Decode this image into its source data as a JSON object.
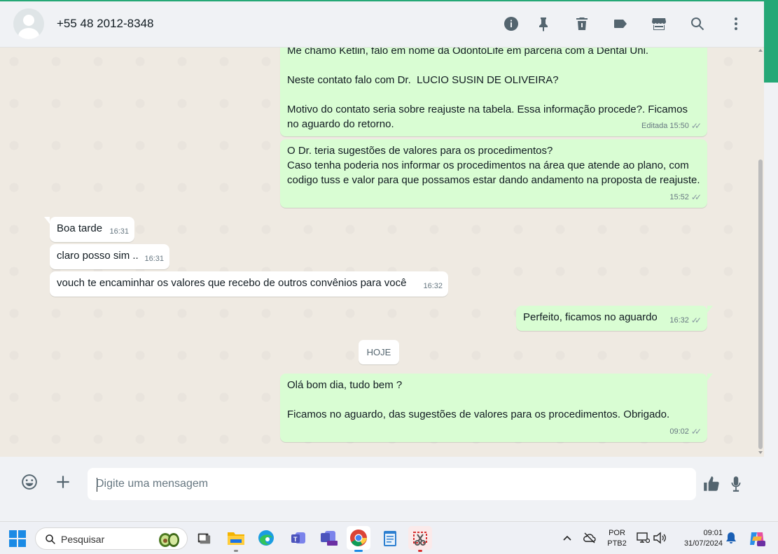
{
  "header": {
    "contact": "+55 48 2012-8348",
    "icons": [
      "info-icon",
      "pin-icon",
      "delete-icon",
      "label-icon",
      "store-icon",
      "search-icon",
      "menu-icon"
    ]
  },
  "messages": [
    {
      "dir": "out",
      "text": "Me chamo Ketlin, falo em nome da OdontoLife em parceria com a Dental Uni.\n\nNeste contato falo com Dr.  LUCIO SUSIN DE OLIVEIRA?\n\nMotivo do contato seria sobre reajuste na tabela. Essa informação procede?. Ficamos no aguardo do retorno.",
      "edited": "Editada",
      "time": "15:50"
    },
    {
      "dir": "out",
      "text": "O Dr. teria sugestões de valores para os procedimentos?\nCaso tenha poderia nos informar os procedimentos na área que atende ao plano, com codigo tuss e valor para que possamos estar dando andamento na proposta de reajuste.",
      "time": "15:52"
    },
    {
      "dir": "in",
      "text": "Boa tarde",
      "time": "16:31"
    },
    {
      "dir": "in",
      "text": "claro posso sim ..",
      "time": "16:31"
    },
    {
      "dir": "in",
      "text": "vouch te encaminhar os valores que recebo de outros convênios para você",
      "time": "16:32"
    },
    {
      "dir": "out",
      "text": "Perfeito, ficamos no aguardo",
      "time": "16:32"
    },
    {
      "dir": "out",
      "text": "Olá bom dia, tudo bem ?\n\nFicamos no aguardo, das sugestões de valores para os procedimentos. Obrigado.",
      "time": "09:02"
    }
  ],
  "date_separator": "HOJE",
  "composer": {
    "placeholder": "Digite uma mensagem",
    "icons": [
      "emoji-icon",
      "plus-icon",
      "thumbs-up-icon",
      "microphone-icon"
    ]
  },
  "taskbar": {
    "search_label": "Pesquisar",
    "lang_top": "POR",
    "lang_bottom": "PTB2",
    "time": "09:01",
    "date": "31/07/2024",
    "apps": [
      "task-view",
      "file-explorer",
      "edge",
      "teams-classic",
      "teams-new",
      "chrome",
      "notepad",
      "snipping-tool"
    ]
  },
  "colors": {
    "accent": "#25a876",
    "outgoing_bubble": "#d9fdd3",
    "incoming_bubble": "#ffffff",
    "chat_background": "#efeae2"
  }
}
